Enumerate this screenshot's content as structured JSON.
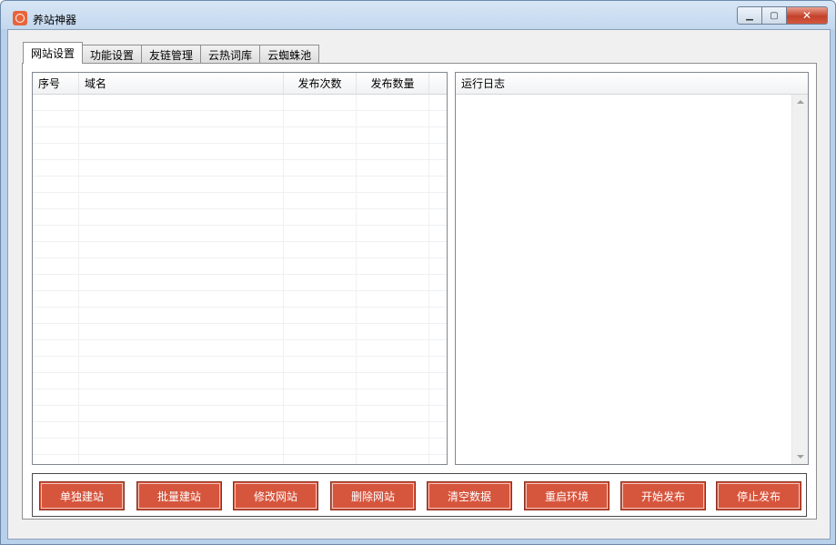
{
  "window": {
    "title": "养站神器"
  },
  "tabs": [
    "网站设置",
    "功能设置",
    "友链管理",
    "云热词库",
    "云蜘蛛池"
  ],
  "list": {
    "columns": [
      "序号",
      "域名",
      "发布次数",
      "发布数量"
    ]
  },
  "log": {
    "header": "运行日志"
  },
  "actions": [
    "单独建站",
    "批量建站",
    "修改网站",
    "删除网站",
    "清空数据",
    "重启环境",
    "开始发布",
    "停止发布"
  ],
  "colors": {
    "action_button": "#d6553d",
    "title_bar": "#c4d8ee"
  },
  "icons": {
    "app": "app-logo-icon",
    "min": "minimize-icon",
    "max": "maximize-icon",
    "close": "close-icon"
  }
}
